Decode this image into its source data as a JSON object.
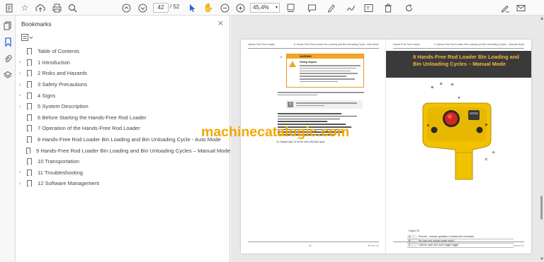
{
  "toolbar": {
    "left_icons": [
      "document-tools-icon",
      "star-icon",
      "upload-icon",
      "print-icon",
      "zoom-search-icon"
    ],
    "page_current": "42",
    "page_total": "/ 52",
    "zoom_value": "45,4%",
    "right_icons": [
      "sign-icon",
      "mail-icon"
    ]
  },
  "rail": {
    "icons": [
      "pages-icon",
      "bookmark-icon",
      "attachment-icon",
      "layers-icon"
    ]
  },
  "bookmarks": {
    "title": "Bookmarks",
    "items": [
      {
        "label": "Table of Contents",
        "expandable": false
      },
      {
        "label": "1 Introduction",
        "expandable": true
      },
      {
        "label": "2 Risks and Hazards",
        "expandable": true
      },
      {
        "label": "3 Safety Precautions",
        "expandable": true
      },
      {
        "label": "4 Signs",
        "expandable": true
      },
      {
        "label": "5 System Description",
        "expandable": true
      },
      {
        "label": "6 Before Starting the Hands-Free Rod Loader",
        "expandable": false
      },
      {
        "label": "7 Operation of the Hands-Free Rod Loader",
        "expandable": false
      },
      {
        "label": "8 Hands-Free Rod Loader Bin Loading and Bin Unloading Cycle - Auto Mode",
        "expandable": false
      },
      {
        "label": "9 Hands-Free Rod Loader Bin Loading and Bin Unloading Cycles – Manual Mode",
        "expandable": false
      },
      {
        "label": "10 Transportation",
        "expandable": false
      },
      {
        "label": "11 Troubleshooting",
        "expandable": true
      },
      {
        "label": "12 Software Management",
        "expandable": true
      }
    ]
  },
  "document": {
    "left_page": {
      "header_left": "Hands-Free Rod Loader",
      "header_right": "8. Hands-Free Rod Loader Bin Loading and Bin Unloading Cycle - Auto Mode",
      "warning_label": "WARNING",
      "warning_subtitle": "Falling Objects",
      "step_15": "15.  Repeat step 13 for the next UNLOAD cycle.",
      "footer_left": "42",
      "footer_right": "Ed. rev 1.0"
    },
    "right_page": {
      "header_left": "Hands-Free Rod Loader",
      "header_right": "9. Hands-Free Rod Loader Bin Loading and Bin Unloading Cycles – Manual Mode",
      "chapter_title": "9  Hands-Free Rod Loader Bin Loading and Bin Unloading Cycles – Manual Mode",
      "figure_caption": "Figure 32",
      "callouts": [
        "E",
        "G",
        "H",
        "F",
        "B",
        "D",
        "A",
        "C"
      ],
      "legend": [
        {
          "key": "A",
          "text": "Remote - manual operation of hands-free rod loader"
        },
        {
          "key": "B",
          "text": "Bin load and unload toggle switch"
        },
        {
          "key": "C",
          "text": "Catcher open and close toggle switch"
        }
      ],
      "footer_left": "43",
      "footer_right": "Ed. rev 1.0"
    }
  },
  "watermark": "machinecatalogic.com",
  "colors": {
    "accent_blue": "#2469d6",
    "chapter_band": "#3a3a3a",
    "chapter_title": "#f4b942",
    "warning_orange": "#f4a623",
    "watermark": "#f2a900",
    "remote_yellow": "#f2c200"
  }
}
